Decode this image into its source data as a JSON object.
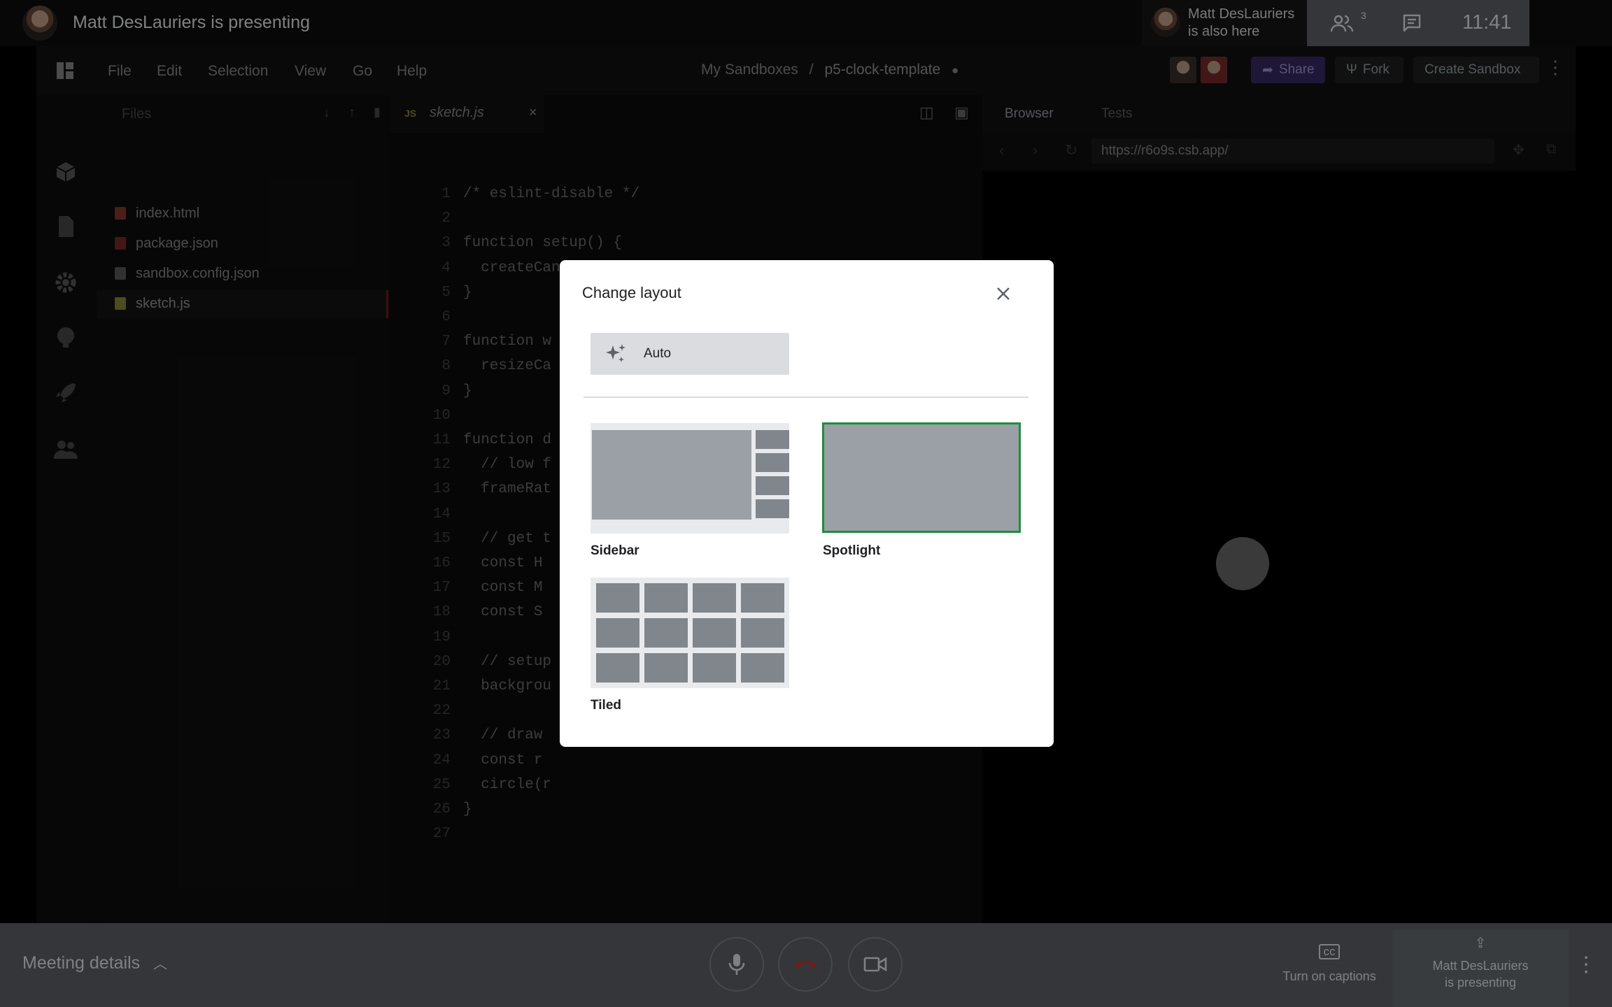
{
  "meet": {
    "presenting_title": "Matt DesLauriers is presenting",
    "also_here_line1": "Matt DesLauriers",
    "also_here_line2": "is also here",
    "people_count": "3",
    "clock": "11:41",
    "meeting_details": "Meeting details",
    "captions_label": "Turn on captions",
    "presenter_line1": "Matt DesLauriers",
    "presenter_line2": "is presenting"
  },
  "sandbox": {
    "menu": [
      "File",
      "Edit",
      "Selection",
      "View",
      "Go",
      "Help"
    ],
    "breadcrumb_parent": "My Sandboxes",
    "breadcrumb_sep": "/",
    "breadcrumb_current": "p5-clock-template",
    "share_label": "Share",
    "fork_label": "Fork",
    "create_label": "Create Sandbox",
    "files_title": "Files",
    "files": [
      {
        "name": "index.html",
        "color": "#8a3a2e"
      },
      {
        "name": "package.json",
        "color": "#7a2a2a"
      },
      {
        "name": "sandbox.config.json",
        "color": "#6e6e6e"
      },
      {
        "name": "sketch.js",
        "color": "#8a8a34"
      }
    ],
    "tab_badge": "JS",
    "tab_name": "sketch.js",
    "line_numbers": "1\n2\n3\n4\n5\n6\n7\n8\n9\n10\n11\n12\n13\n14\n15\n16\n17\n18\n19\n20\n21\n22\n23\n24\n25\n26\n27",
    "code": "/* eslint-disable */\n\nfunction setup() {\n  createCanvas(windowWidth, windowHeight);\n}\n\nfunction w\n  resizeCa\n}\n\nfunction d\n  // low f\n  frameRat\n\n  // get t\n  const H \n  const M \n  const S \n\n  // setup\n  backgrou\n\n  // draw \n  const r \n  circle(r\n}\n",
    "browser_tab": "Browser",
    "tests_tab": "Tests",
    "url": "https://r6o9s.csb.app/"
  },
  "dialog": {
    "title": "Change layout",
    "auto_label": "Auto",
    "options": {
      "sidebar": "Sidebar",
      "spotlight": "Spotlight",
      "tiled": "Tiled"
    },
    "selected": "spotlight",
    "selected_color": "#1e8e3e"
  }
}
